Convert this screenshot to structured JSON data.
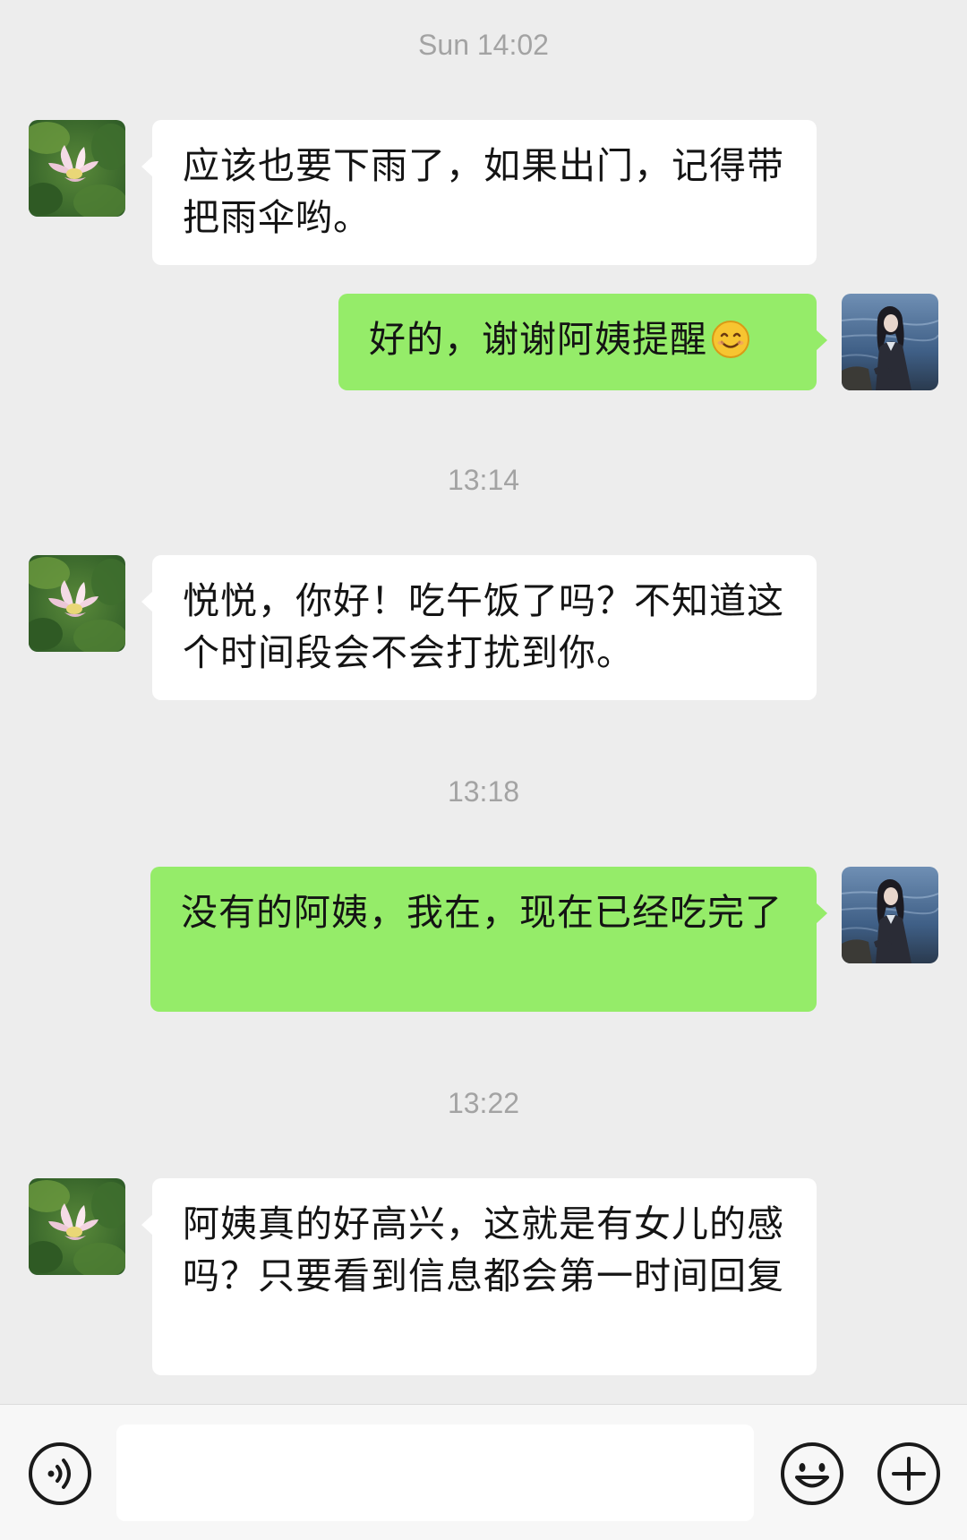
{
  "messages": [
    {
      "type": "timestamp",
      "text": "Sun 14:02"
    },
    {
      "type": "incoming",
      "sender": "aunt",
      "text": "应该也要下雨了，如果出门，记得带把雨伞哟。"
    },
    {
      "type": "outgoing",
      "sender": "me",
      "text": "好的，谢谢阿姨提醒",
      "emoji": "smile-emoji"
    },
    {
      "type": "timestamp",
      "text": "13:14"
    },
    {
      "type": "incoming",
      "sender": "aunt",
      "text": "悦悦，你好！吃午饭了吗？不知道这个时间段会不会打扰到你。"
    },
    {
      "type": "timestamp",
      "text": "13:18"
    },
    {
      "type": "outgoing",
      "sender": "me",
      "text": "没有的阿姨，我在，现在已经吃完了"
    },
    {
      "type": "timestamp",
      "text": "13:22"
    },
    {
      "type": "incoming",
      "sender": "aunt",
      "text": "阿姨真的好高兴，这就是有女儿的感吗？只要看到信息都会第一时间回复"
    }
  ],
  "input_bar": {
    "voice_icon": "voice-icon",
    "text_value": "",
    "emoji_icon": "emoji-icon",
    "plus_icon": "plus-icon"
  },
  "colors": {
    "background": "#ededed",
    "incoming_bubble": "#ffffff",
    "outgoing_bubble": "#95ec69",
    "timestamp_text": "#a3a3a3"
  }
}
